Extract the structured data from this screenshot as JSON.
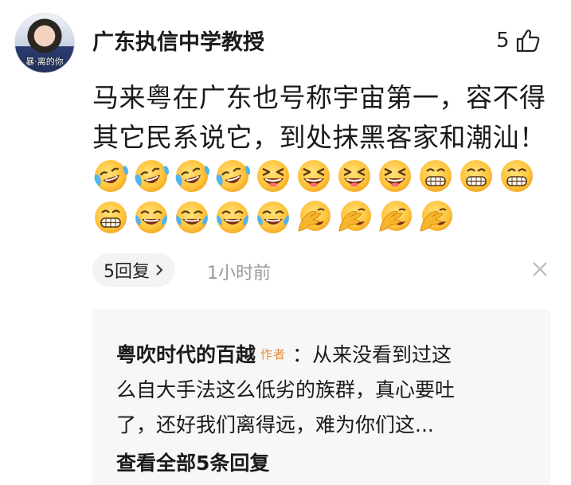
{
  "comment": {
    "avatar_caption": "暴·离的你",
    "username": "广东执信中学教授",
    "like_count": "5",
    "text_line1": "马来粤在广东也号称宇宙第一，容不得",
    "text_line2": "其它民系说它，到处抹黑客家和潮汕！",
    "emojis_row1": [
      "laugh-cry-tilted-icon",
      "laugh-cry-tilted-icon",
      "laugh-cry-tilted-icon",
      "laugh-cry-tilted-icon",
      "grin-squint-icon",
      "grin-squint-icon",
      "grin-squint-icon",
      "grin-squint-icon",
      "grin-teeth-icon",
      "grin-teeth-icon",
      "grin-teeth-icon"
    ],
    "emojis_row2": [
      "grin-teeth-icon",
      "tears-of-joy-icon",
      "tears-of-joy-icon",
      "tears-of-joy-icon",
      "tears-of-joy-icon",
      "facepalm-laugh-icon",
      "facepalm-laugh-icon",
      "facepalm-laugh-icon",
      "facepalm-laugh-icon"
    ],
    "reply_count_label": "5回复",
    "time_ago": "1小时前"
  },
  "reply": {
    "author": "粤吹时代的百越",
    "author_badge": "作者",
    "line1_rest": "：从来没看到过这",
    "line2": "么自大手法这么低劣的族群，真心要吐",
    "line3": "了，还好我们离得远，难为你们这...",
    "view_all": "查看全部5条回复"
  },
  "colors": {
    "emoji_yellow": "#ffc23a",
    "badge_orange": "#e88b3b",
    "muted_gray": "#9a9a9a",
    "reply_bg": "#f7f7f7"
  }
}
